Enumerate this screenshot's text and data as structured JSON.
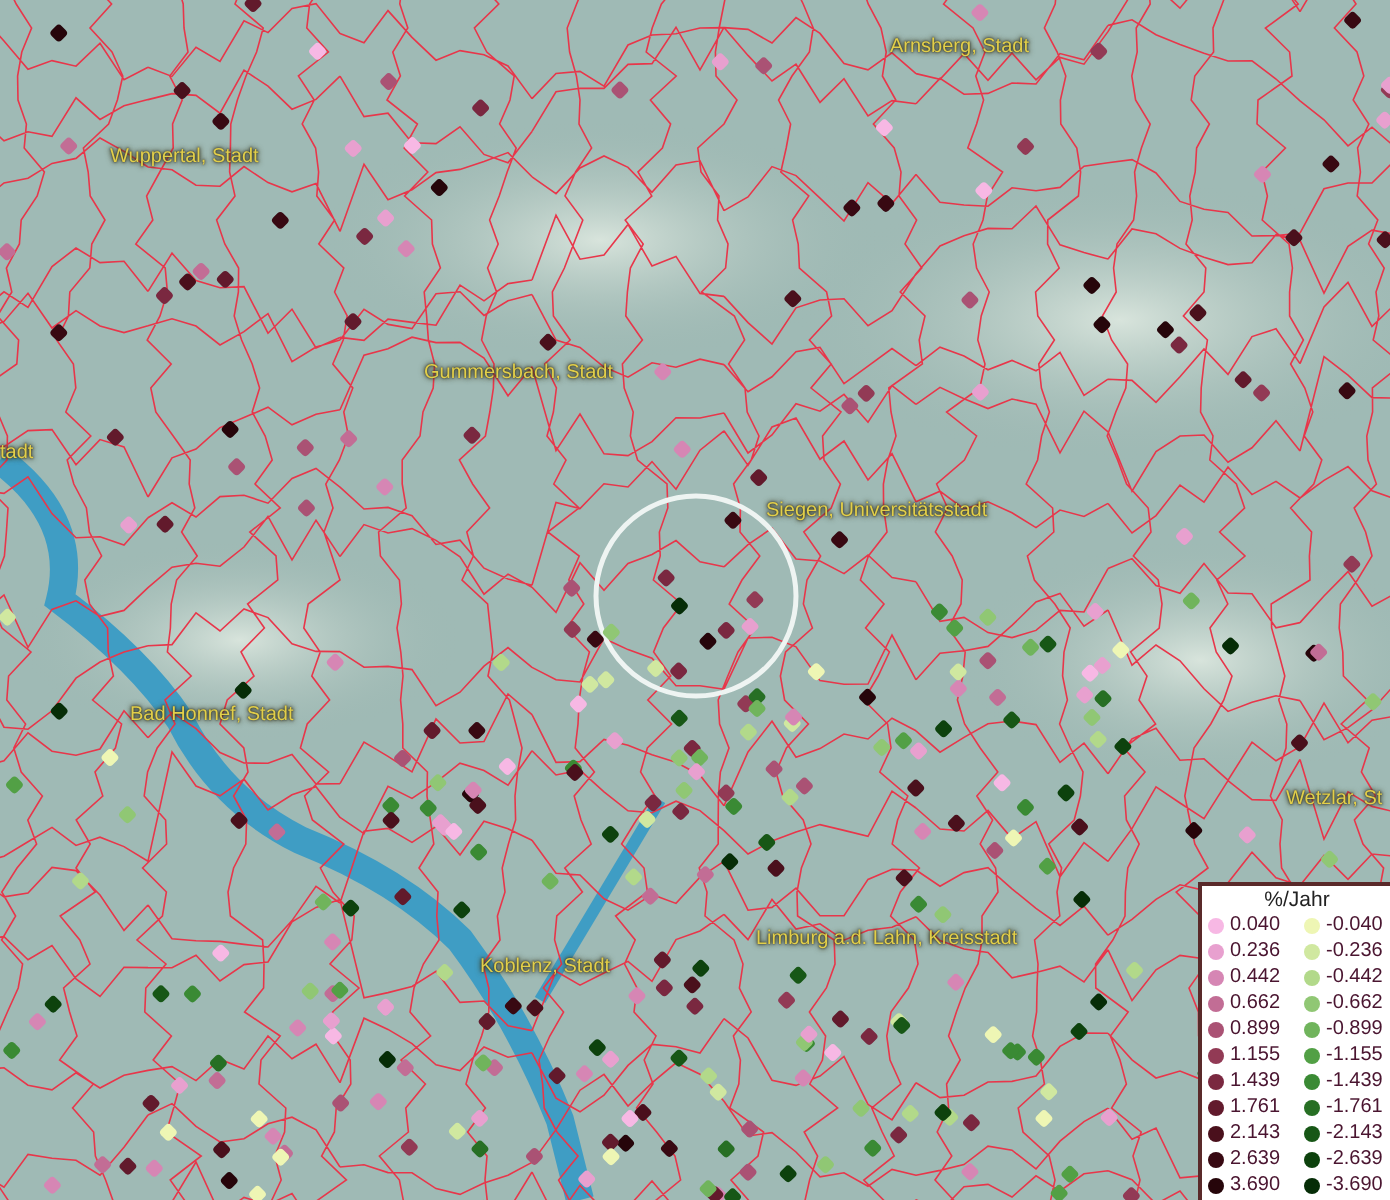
{
  "map": {
    "places": [
      {
        "name": "Arnsberg, Stadt"
      },
      {
        "name": "Wuppertal, Stadt"
      },
      {
        "name": "Gummersbach, Stadt"
      },
      {
        "name": "tadt"
      },
      {
        "name": "Siegen, Universitätsstadt"
      },
      {
        "name": "Bad Honnef, Stadt"
      },
      {
        "name": "Wetzlar, St"
      },
      {
        "name": "Limburg a.d. Lahn, Kreisstadt"
      },
      {
        "name": "Koblenz, Stadt"
      }
    ]
  },
  "legend": {
    "title": "%/Jahr",
    "positive": [
      {
        "value": "0.040",
        "color": "#f7b8e4"
      },
      {
        "value": "0.236",
        "color": "#e8a0cf"
      },
      {
        "value": "0.442",
        "color": "#d686b4"
      },
      {
        "value": "0.662",
        "color": "#c26d95"
      },
      {
        "value": "0.899",
        "color": "#aa5274"
      },
      {
        "value": "1.155",
        "color": "#923a55"
      },
      {
        "value": "1.439",
        "color": "#7a2840"
      },
      {
        "value": "1.761",
        "color": "#621a2c"
      },
      {
        "value": "2.143",
        "color": "#4a101c"
      },
      {
        "value": "2.639",
        "color": "#380912"
      },
      {
        "value": "3.690",
        "color": "#26050a"
      }
    ],
    "negative": [
      {
        "value": "-0.040",
        "color": "#eef6b4"
      },
      {
        "value": "-0.236",
        "color": "#d0e8a0"
      },
      {
        "value": "-0.442",
        "color": "#b2d98a"
      },
      {
        "value": "-0.662",
        "color": "#90c774"
      },
      {
        "value": "-0.899",
        "color": "#70b45c"
      },
      {
        "value": "-1.155",
        "color": "#52a045"
      },
      {
        "value": "-1.439",
        "color": "#3a8a34"
      },
      {
        "value": "-1.761",
        "color": "#276f24"
      },
      {
        "value": "-2.143",
        "color": "#175716"
      },
      {
        "value": "-2.639",
        "color": "#0d420d"
      },
      {
        "value": "-3.690",
        "color": "#062d07"
      }
    ]
  }
}
